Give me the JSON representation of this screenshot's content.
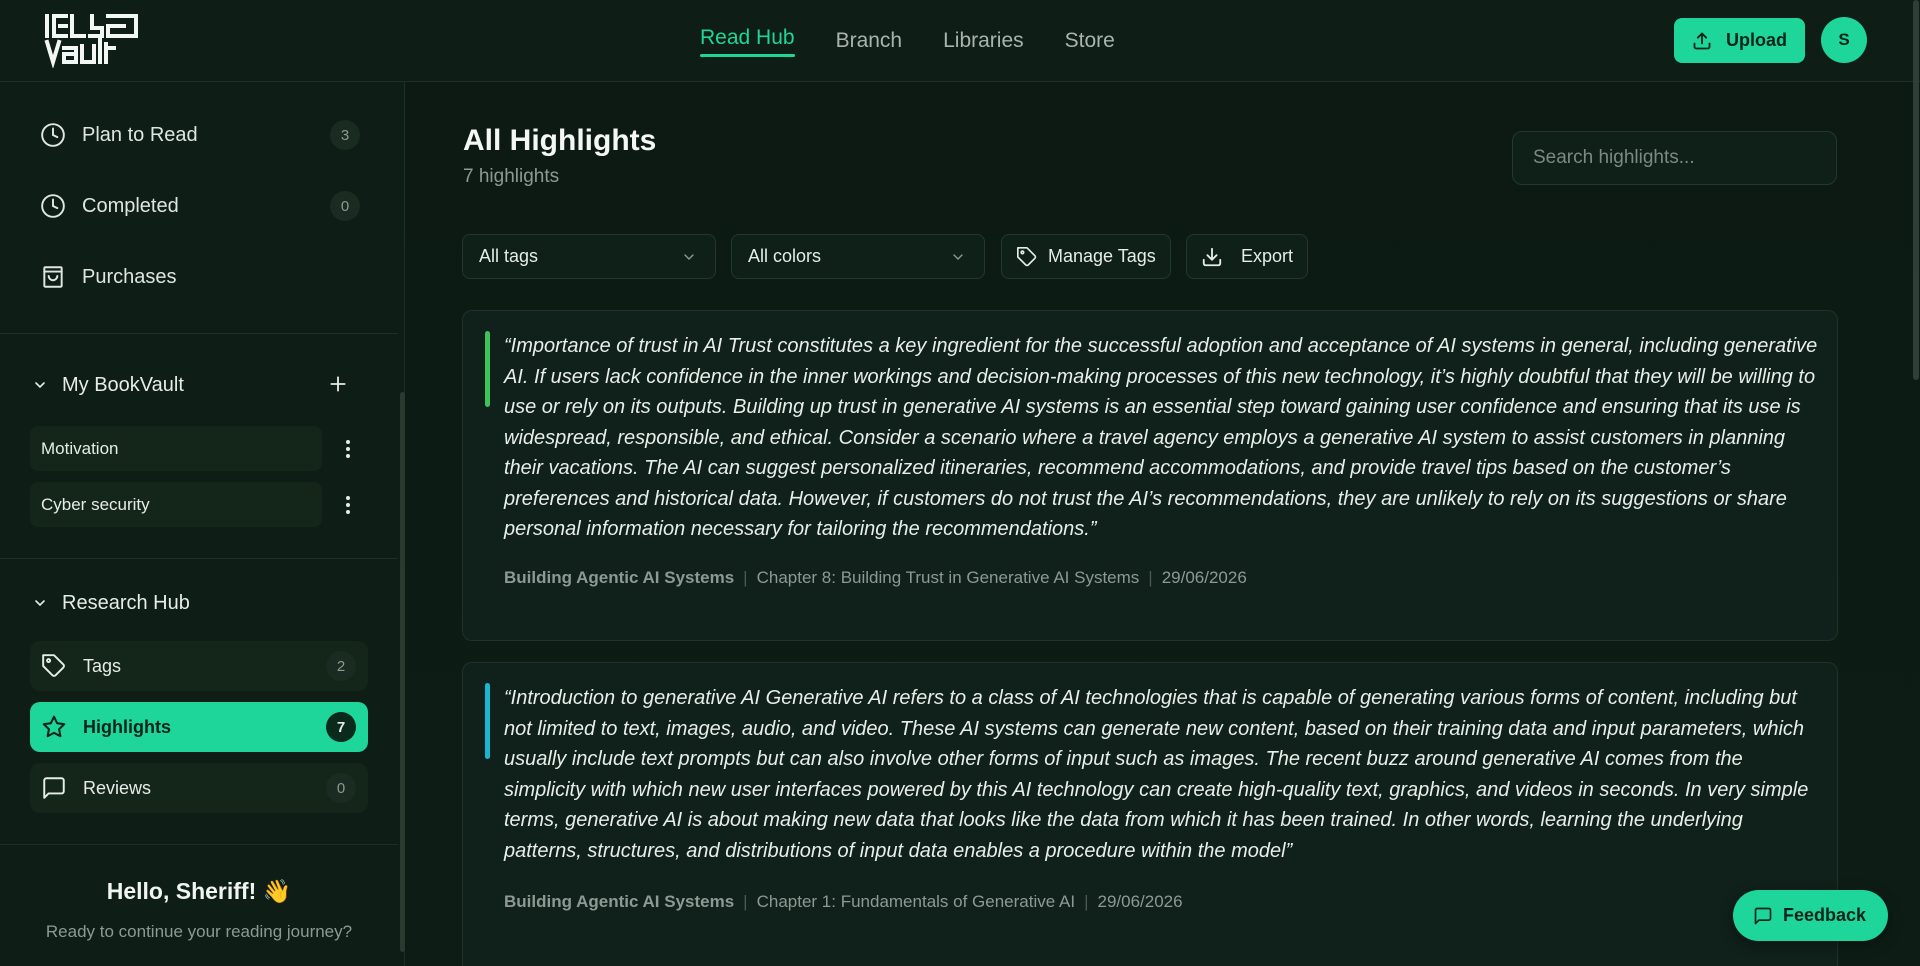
{
  "brand": {
    "logo_text": "Vault",
    "accent": "#1fd69a"
  },
  "topnav": {
    "items": [
      {
        "label": "Read Hub",
        "active": true
      },
      {
        "label": "Branch",
        "active": false
      },
      {
        "label": "Libraries",
        "active": false
      },
      {
        "label": "Store",
        "active": false
      }
    ],
    "upload_label": "Upload",
    "avatar_initial": "S"
  },
  "sidebar": {
    "status_items": [
      {
        "label": "Plan to Read",
        "count": "3",
        "icon": "clock-icon"
      },
      {
        "label": "Completed",
        "count": "0",
        "icon": "clock-icon"
      },
      {
        "label": "Purchases",
        "icon": "shopping-bag-icon"
      }
    ],
    "my_vault": {
      "title": "My BookVault",
      "collections": [
        "Motivation",
        "Cyber security"
      ]
    },
    "research_hub": {
      "title": "Research Hub",
      "items": [
        {
          "label": "Tags",
          "count": "2",
          "icon": "tag-icon",
          "active": false
        },
        {
          "label": "Highlights",
          "count": "7",
          "icon": "star-icon",
          "active": true
        },
        {
          "label": "Reviews",
          "count": "0",
          "icon": "message-square-icon",
          "active": false
        }
      ]
    },
    "greeting": {
      "title": "Hello, Sheriff! 👋",
      "subtitle": "Ready to continue your reading journey?"
    }
  },
  "main": {
    "title": "All Highlights",
    "subtitle": "7 highlights",
    "search_placeholder": "Search highlights...",
    "filters": {
      "tags": "All tags",
      "colors": "All colors"
    },
    "manage_tags_label": "Manage Tags",
    "export_label": "Export",
    "highlights": [
      {
        "color": "#3fc25a",
        "text": "“Importance of trust in AI Trust constitutes a key ingredient for the successful adoption and acceptance of AI systems in general, including generative AI. If users lack confidence in the inner workings and decision-making processes of this new technology, it’s highly doubtful that they will be willing to use or rely on its outputs. Building up trust in generative AI systems is an essential step toward gaining user confidence and ensuring that its use is widespread, responsible, and ethical. Consider a scenario where a travel agency employs a generative AI system to assist customers in planning their vacations. The AI can suggest personalized itineraries, recommend accommodations, and provide travel tips based on the customer’s preferences and historical data. However, if customers do not trust the AI’s recommendations, they are unlikely to rely on its suggestions or share personal information necessary for tailoring the recommendations.”",
        "book": "Building Agentic AI Systems",
        "chapter": "Chapter 8: Building Trust in Generative AI Systems",
        "date": "29/06/2026"
      },
      {
        "color": "#18b6d0",
        "text": "“Introduction to generative AI Generative AI refers to a class of AI technologies that is capable of generating various forms of content, including but not limited to text, images, audio, and video. These AI systems can generate new content, based on their training data and input parameters, which usually include text prompts but can also involve other forms of input such as images. The recent buzz around generative AI comes from the simplicity with which new user interfaces powered by this AI technology can create high-quality text, graphics, and videos in seconds. In very simple terms, generative AI is about making new data that looks like the data from which it has been trained. In other words, learning the underlying patterns, structures, and distributions of input data enables a procedure within the model”",
        "book": "Building Agentic AI Systems",
        "chapter": "Chapter 1: Fundamentals of Generative AI",
        "date": "29/06/2026"
      }
    ]
  },
  "feedback_label": "Feedback"
}
